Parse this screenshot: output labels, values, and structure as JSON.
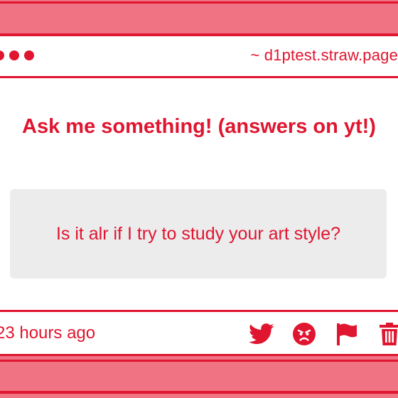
{
  "browser": {
    "url": "~ d1ptest.straw.page"
  },
  "card": {
    "title": "Ask me something! (answers on yt!)",
    "question": "Is it alr if I try to study your art style?",
    "timestamp": "23 hours ago"
  },
  "actions": [
    {
      "name": "twitter-icon"
    },
    {
      "name": "angry-face-icon"
    },
    {
      "name": "flag-icon"
    },
    {
      "name": "trash-icon"
    }
  ],
  "colors": {
    "accent": "#e0152f",
    "band": "#f07383",
    "card_bg": "#ececed"
  }
}
